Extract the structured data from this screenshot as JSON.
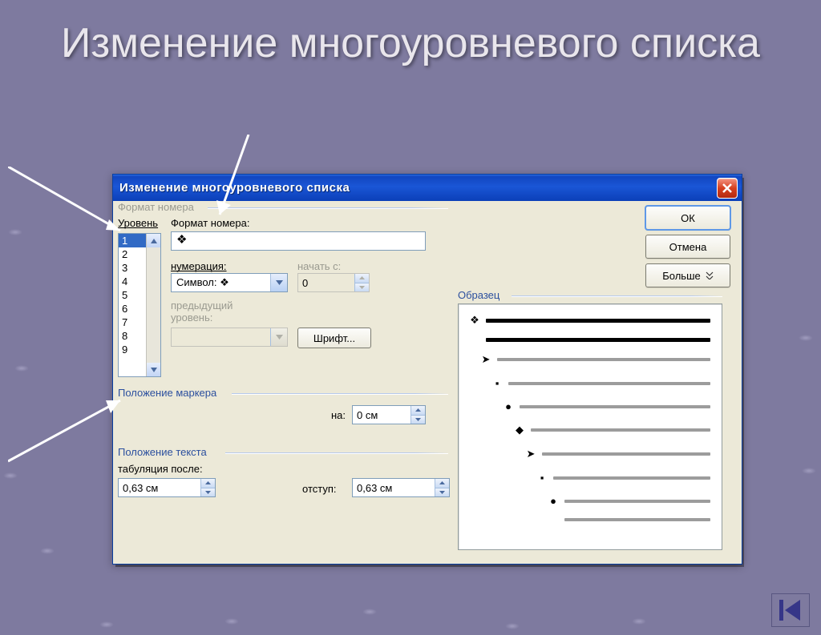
{
  "slide": {
    "title": "Изменение многоуровневого списка"
  },
  "dialog": {
    "title": "Изменение многоуровневого списка",
    "buttons": {
      "ok": "ОК",
      "cancel": "Отмена",
      "more": "Больше",
      "font": "Шрифт..."
    },
    "groups": {
      "number_format": "Формат номера",
      "marker_pos": "Положение маркера",
      "text_pos": "Положение текста",
      "preview": "Образец"
    },
    "labels": {
      "level": "Уровень",
      "number_format": "Формат номера:",
      "numbering": "нумерация:",
      "start_at": "начать с:",
      "prev_level": "предыдущий уровень:",
      "marker_at": "на:",
      "tab_after": "табуляция после:",
      "indent": "отступ:"
    },
    "values": {
      "levels": [
        "1",
        "2",
        "3",
        "4",
        "5",
        "6",
        "7",
        "8",
        "9"
      ],
      "selected_level": "1",
      "number_format_value": "❖",
      "numbering_value": "Символ:  ❖",
      "start_at_value": "0",
      "marker_at": "0 см",
      "tab_after": "0,63 см",
      "indent": "0,63 см"
    },
    "preview_rows": [
      {
        "indent": 0,
        "bullet": "❖",
        "bold": true
      },
      {
        "indent": 0,
        "bullet": "",
        "bold": true
      },
      {
        "indent": 14,
        "bullet": "➤",
        "bold": false
      },
      {
        "indent": 28,
        "bullet": "▪",
        "bold": false
      },
      {
        "indent": 42,
        "bullet": "●",
        "bold": false
      },
      {
        "indent": 56,
        "bullet": "◆",
        "bold": false
      },
      {
        "indent": 70,
        "bullet": "➤",
        "bold": false
      },
      {
        "indent": 84,
        "bullet": "▪",
        "bold": false
      },
      {
        "indent": 98,
        "bullet": "●",
        "bold": false
      },
      {
        "indent": 98,
        "bullet": "",
        "bold": false
      }
    ]
  }
}
